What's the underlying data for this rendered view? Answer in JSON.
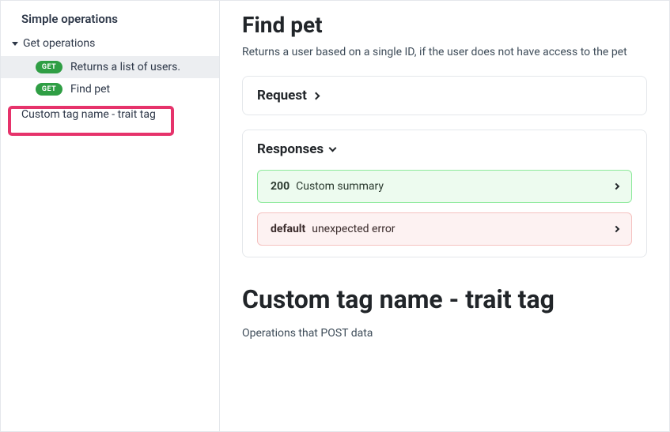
{
  "sidebar": {
    "group_title": "Simple operations",
    "collapsible_label": "Get operations",
    "items": [
      {
        "method": "GET",
        "label": "Returns a list of users."
      },
      {
        "method": "GET",
        "label": "Find pet"
      }
    ],
    "plain_item": "Custom tag name - trait tag"
  },
  "main": {
    "title": "Find pet",
    "description": "Returns a user based on a single ID, if the user does not have access to the pet",
    "request_header": "Request",
    "responses_header": "Responses",
    "responses": [
      {
        "code": "200",
        "summary": "Custom summary",
        "kind": "success"
      },
      {
        "code": "default",
        "summary": "unexpected error",
        "kind": "error"
      }
    ],
    "section2_title": "Custom tag name - trait tag",
    "section2_desc": "Operations that POST data"
  }
}
